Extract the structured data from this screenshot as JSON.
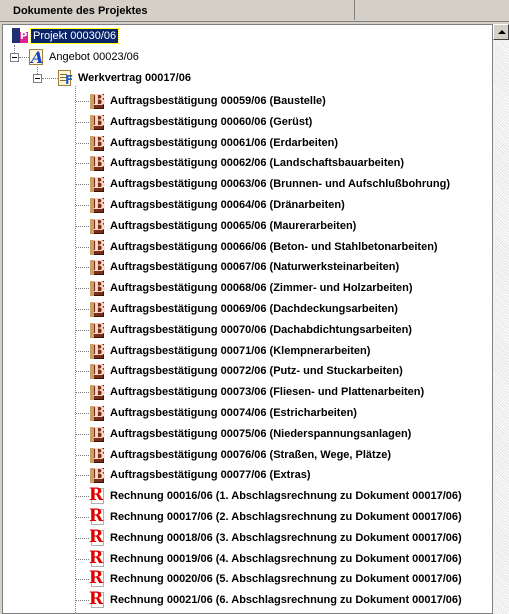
{
  "panel": {
    "header_title": "Dokumente des Projektes"
  },
  "tree": {
    "root": {
      "label": "Projekt 00030/06",
      "icon": "project-icon",
      "selected": true
    },
    "offer": {
      "label": "Angebot 00023/06",
      "icon": "offer-document-icon"
    },
    "contract": {
      "label": "Werkvertrag 00017/06",
      "icon": "contract-document-icon"
    },
    "items": [
      {
        "label": "Auftragsbestätigung 00059/06 (Baustelle)",
        "icon": "order-confirmation-icon"
      },
      {
        "label": "Auftragsbestätigung 00060/06 (Gerüst)",
        "icon": "order-confirmation-icon"
      },
      {
        "label": "Auftragsbestätigung 00061/06 (Erdarbeiten)",
        "icon": "order-confirmation-icon"
      },
      {
        "label": "Auftragsbestätigung 00062/06 (Landschaftsbauarbeiten)",
        "icon": "order-confirmation-icon"
      },
      {
        "label": "Auftragsbestätigung 00063/06 (Brunnen- und Aufschlußbohrung)",
        "icon": "order-confirmation-icon"
      },
      {
        "label": "Auftragsbestätigung 00064/06 (Dränarbeiten)",
        "icon": "order-confirmation-icon"
      },
      {
        "label": "Auftragsbestätigung 00065/06 (Maurerarbeiten)",
        "icon": "order-confirmation-icon"
      },
      {
        "label": "Auftragsbestätigung 00066/06 (Beton- und Stahlbetonarbeiten)",
        "icon": "order-confirmation-icon"
      },
      {
        "label": "Auftragsbestätigung 00067/06 (Naturwerksteinarbeiten)",
        "icon": "order-confirmation-icon"
      },
      {
        "label": "Auftragsbestätigung 00068/06 (Zimmer- und Holzarbeiten)",
        "icon": "order-confirmation-icon"
      },
      {
        "label": "Auftragsbestätigung 00069/06 (Dachdeckungsarbeiten)",
        "icon": "order-confirmation-icon"
      },
      {
        "label": "Auftragsbestätigung 00070/06 (Dachabdichtungsarbeiten)",
        "icon": "order-confirmation-icon"
      },
      {
        "label": "Auftragsbestätigung 00071/06 (Klempnerarbeiten)",
        "icon": "order-confirmation-icon"
      },
      {
        "label": "Auftragsbestätigung 00072/06 (Putz- und Stuckarbeiten)",
        "icon": "order-confirmation-icon"
      },
      {
        "label": "Auftragsbestätigung 00073/06 (Fliesen- und Plattenarbeiten)",
        "icon": "order-confirmation-icon"
      },
      {
        "label": "Auftragsbestätigung 00074/06 (Estricharbeiten)",
        "icon": "order-confirmation-icon"
      },
      {
        "label": "Auftragsbestätigung 00075/06 (Niederspannungsanlagen)",
        "icon": "order-confirmation-icon"
      },
      {
        "label": "Auftragsbestätigung 00076/06 (Straßen, Wege, Plätze)",
        "icon": "order-confirmation-icon"
      },
      {
        "label": "Auftragsbestätigung 00077/06 (Extras)",
        "icon": "order-confirmation-icon"
      },
      {
        "label": "Rechnung 00016/06 (1. Abschlagsrechnung zu Dokument 00017/06)",
        "icon": "invoice-icon"
      },
      {
        "label": "Rechnung 00017/06 (2. Abschlagsrechnung zu Dokument 00017/06)",
        "icon": "invoice-icon"
      },
      {
        "label": "Rechnung 00018/06 (3. Abschlagsrechnung zu Dokument 00017/06)",
        "icon": "invoice-icon"
      },
      {
        "label": "Rechnung 00019/06 (4. Abschlagsrechnung zu Dokument 00017/06)",
        "icon": "invoice-icon"
      },
      {
        "label": "Rechnung 00020/06 (5. Abschlagsrechnung zu Dokument 00017/06)",
        "icon": "invoice-icon"
      },
      {
        "label": "Rechnung 00021/06 (6. Abschlagsrechnung zu Dokument 00017/06)",
        "icon": "invoice-icon"
      }
    ]
  },
  "colors": {
    "selection_bg": "#0a246a",
    "invoice_red": "#e00000",
    "book_brown": "#7b2f1a"
  }
}
